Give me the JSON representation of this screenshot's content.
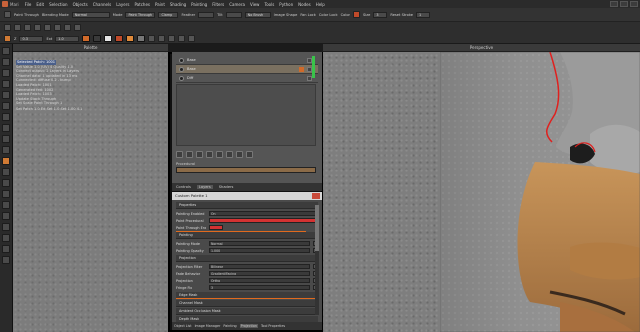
{
  "window": {
    "title": "Mari",
    "menus": [
      "File",
      "Edit",
      "Selection",
      "Objects",
      "Channels",
      "Layers",
      "Patches",
      "Paint",
      "Shading",
      "Painting",
      "Filters",
      "Camera",
      "View",
      "Tools",
      "Python",
      "Nodes",
      "Help"
    ]
  },
  "toolbar1": {
    "paint_through_label": "Paint Through",
    "blending_mode_label": "Blending Mode",
    "blending_mode_value": "Normal",
    "mode_label": "Mode",
    "mode_value": "Paint Through",
    "paint_btn": "Clamp",
    "feather_label": "Feather",
    "tilt_label": "Tilt",
    "brush_field": "No Brush",
    "image_shape_label": "Image Shape",
    "fan_lock_label": "Fan Lock",
    "color_lock_label": "Color Lock",
    "color_label": "Color",
    "size_label": "Size",
    "size_value": "3",
    "reset_label": "Reset Stroke",
    "opacity_value": "1"
  },
  "toolbar2": {
    "z1_label": "Z",
    "z1_value": "0.3",
    "z2_label": "Ext",
    "z2_value": "1.0",
    "swatch_colors": [
      "#d06a2a",
      "#3a3a3a",
      "#e6e6e6",
      "#c04a2a",
      "#e08a3a",
      "#777777"
    ]
  },
  "viewports": {
    "left_tab": "Palette",
    "middle_tab": "Perspective",
    "right_tab": "UVs"
  },
  "console": {
    "lines": [
      "Selected Patch: 1001",
      "Set Value 1.0 (UV) 4 Quality 1.0",
      "Connect output: 2 Layers in Layers",
      "Channel data: 1 updated in 13 ms",
      "Connected: diffuse 0.2 - bump",
      "Loaded Patch: 1001",
      "Generated fed: 1002",
      "Loaded Patch: 1003",
      "Update Stack Through",
      "Set Scale Paint Through 1"
    ],
    "status": "Set Patch 1.0   Ed Set 1.0   Set 1.00 4.1"
  },
  "layers_panel": {
    "layers": [
      {
        "name": "Base",
        "selected": false
      },
      {
        "name": "Base",
        "selected": true
      },
      {
        "name": "Diff",
        "selected": false
      }
    ],
    "procedural_label": "Procedural",
    "tabs": [
      "Controls",
      "Layers",
      "Shaders"
    ],
    "active_tab": "Layers"
  },
  "custom_palette": {
    "title": "Custom Palette 1",
    "section_label": "Properties",
    "rows": [
      {
        "label": "Painting Enabled",
        "value": "On"
      },
      {
        "label": "Paint Procedural",
        "value": "",
        "red": true
      },
      {
        "label": "Paint Through Enabled",
        "value": "",
        "red": true
      },
      {
        "label": "Painting",
        "value": "",
        "group": true
      },
      {
        "label": "Painting Mode",
        "value": "Normal"
      },
      {
        "label": "Painting Opacity",
        "value": "1.000"
      },
      {
        "label": "Projection",
        "value": "",
        "group": true
      },
      {
        "label": "Projection Filter",
        "value": "Bilinear"
      },
      {
        "label": "Fade Behavior",
        "value": "Gradient/Facing"
      },
      {
        "label": "Projection",
        "value": "Ortho"
      },
      {
        "label": "Fringe Fix",
        "value": "3"
      },
      {
        "label": "Edge Mask",
        "value": "",
        "group": true,
        "orange": true
      },
      {
        "label": "Channel Mask",
        "value": "",
        "group": true
      },
      {
        "label": "Ambient Occlusion Mask",
        "value": "",
        "group": true
      },
      {
        "label": "Depth Mask",
        "value": "",
        "group": true
      },
      {
        "label": "Options",
        "value": "",
        "group": true
      }
    ],
    "bottom_tabs": [
      "Object List",
      "Image Manager",
      "Painting",
      "Projection",
      "Tool Properties"
    ],
    "active_bottom_tab": "Projection"
  }
}
